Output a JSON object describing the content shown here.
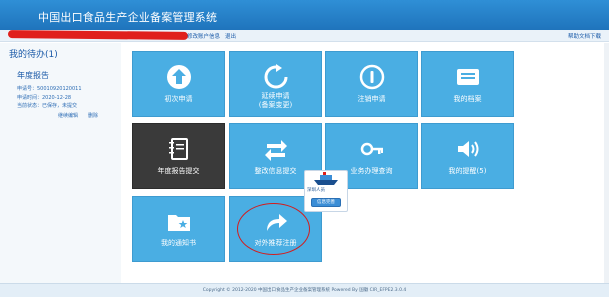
{
  "header": {
    "title": "中国出口食品生产企业备案管理系统"
  },
  "topbar": {
    "edit_account": "修改账户信息",
    "logout": "退出",
    "help": "帮助文档下载"
  },
  "sidebar": {
    "todo_title": "我的待办(1)",
    "report": {
      "title": "年度报告",
      "lines": [
        "申请号：50010920120011",
        "申请时间：2020-12-28",
        "当前状态：已保存，未提交"
      ],
      "actions": [
        "继续编辑",
        "删除"
      ]
    }
  },
  "tiles": [
    {
      "label": "初次申请",
      "icon": "arrow-up-circle-icon",
      "dark": false
    },
    {
      "label": "延续申请\n(备案变更)",
      "icon": "refresh-icon",
      "dark": false
    },
    {
      "label": "注销申请",
      "icon": "info-circle-icon",
      "dark": false
    },
    {
      "label": "我的档案",
      "icon": "archive-icon",
      "dark": false
    },
    {
      "label": "年度报告提交",
      "icon": "notebook-icon",
      "dark": true
    },
    {
      "label": "整改信息提交",
      "icon": "transfer-arrows-icon",
      "dark": false
    },
    {
      "label": "业务办理查询",
      "icon": "key-icon",
      "dark": false
    },
    {
      "label": "我的提醒(5)",
      "icon": "speaker-icon",
      "dark": false
    },
    {
      "label": "我的通知书",
      "icon": "star-folder-icon",
      "dark": false
    },
    {
      "label": "对外推荐注册",
      "icon": "share-arrow-icon",
      "dark": false
    }
  ],
  "popup": {
    "top_text": "深圳人员",
    "button": "信息完善"
  },
  "footer": {
    "text": "Copyright © 2012-2020 中国出口食品生产企业备案管理系统 Powered By 国徽 CIR_EFPE2.3.0.4"
  },
  "colors": {
    "header": "#1f74bc",
    "tile": "#4aaee3",
    "tile_dark": "#3a3a3a",
    "annotation": "#d41c1c"
  }
}
